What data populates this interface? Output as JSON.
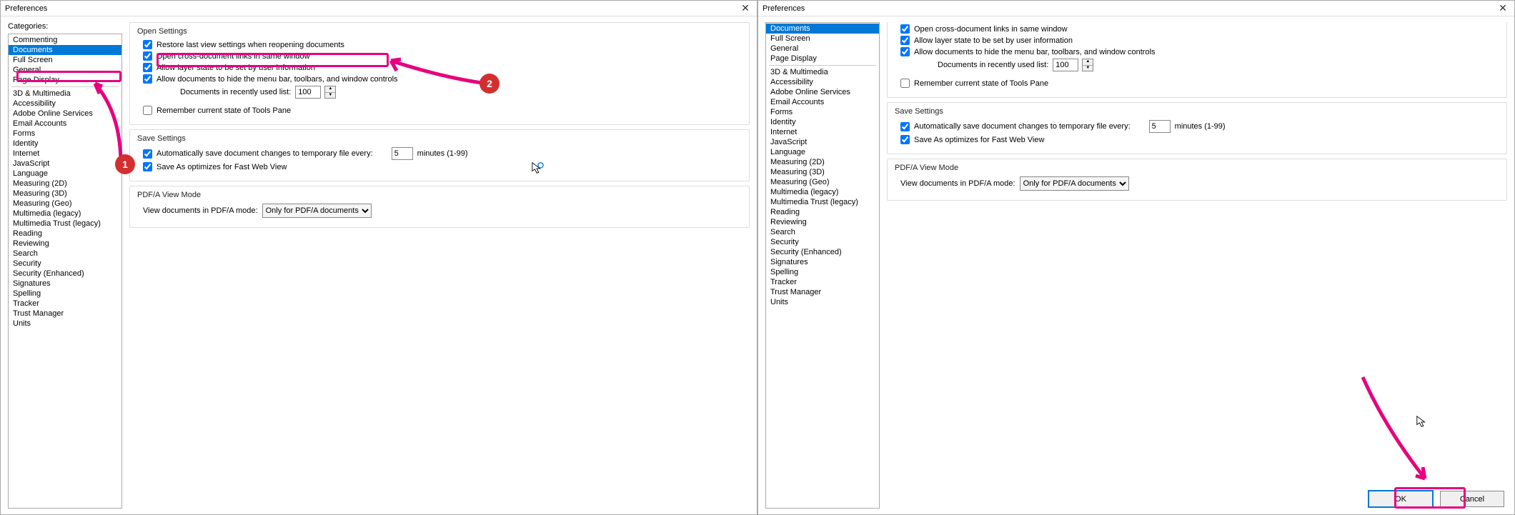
{
  "window_title": "Preferences",
  "categories_label": "Categories:",
  "cat_groups": [
    [
      "Commenting",
      "Documents",
      "Full Screen",
      "General",
      "Page Display"
    ],
    [
      "3D & Multimedia",
      "Accessibility",
      "Adobe Online Services",
      "Email Accounts",
      "Forms",
      "Identity",
      "Internet",
      "JavaScript",
      "Language",
      "Measuring (2D)",
      "Measuring (3D)",
      "Measuring (Geo)",
      "Multimedia (legacy)",
      "Multimedia Trust (legacy)",
      "Reading",
      "Reviewing",
      "Search",
      "Security",
      "Security (Enhanced)",
      "Signatures",
      "Spelling",
      "Tracker",
      "Trust Manager",
      "Units"
    ]
  ],
  "selected_cat": "Documents",
  "open_settings_title": "Open Settings",
  "open_settings": {
    "restore_view": "Restore last view settings when reopening documents",
    "cross_doc": "Open cross-document links in same window",
    "layer_state": "Allow layer state to be set by user information",
    "hide_bars": "Allow documents to hide the menu bar, toolbars, and window controls",
    "recent_label": "Documents in recently used list:",
    "recent_value": "100",
    "remember_pane": "Remember current state of Tools Pane"
  },
  "save_settings_title": "Save Settings",
  "save_settings": {
    "autosave": "Automatically save document changes to temporary file every:",
    "autosave_val": "5",
    "autosave_unit": "minutes (1-99)",
    "fastweb": "Save As optimizes for Fast Web View"
  },
  "pdfa_title": "PDF/A View Mode",
  "pdfa": {
    "label": "View documents in PDF/A mode:",
    "value": "Only for PDF/A documents"
  },
  "ok_label": "OK",
  "cancel_label": "Cancel"
}
